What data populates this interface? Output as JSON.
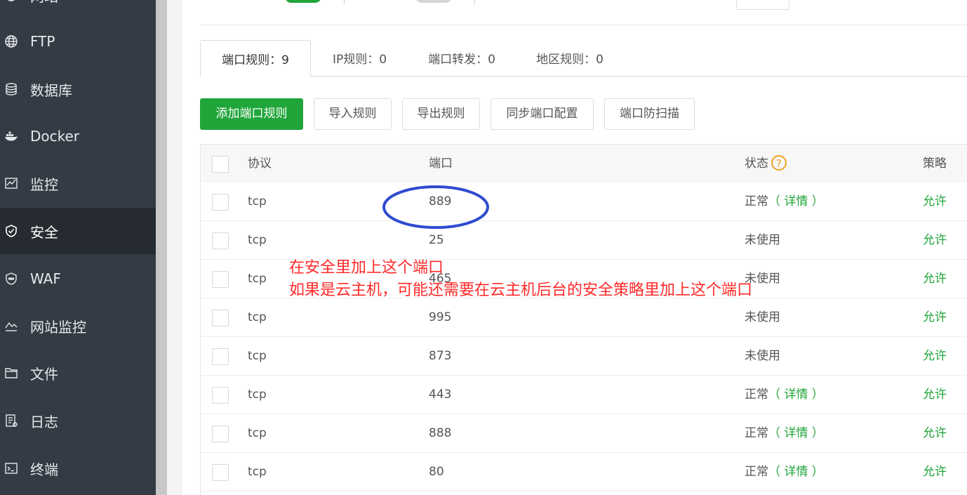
{
  "sidebar": {
    "items": [
      {
        "label": "网站",
        "icon": "globe-icon"
      },
      {
        "label": "FTP",
        "icon": "globe-icon"
      },
      {
        "label": "数据库",
        "icon": "database-icon"
      },
      {
        "label": "Docker",
        "icon": "docker-icon"
      },
      {
        "label": "监控",
        "icon": "monitor-chart-icon"
      },
      {
        "label": "安全",
        "icon": "shield-icon",
        "active": true
      },
      {
        "label": "WAF",
        "icon": "waf-shield-icon"
      },
      {
        "label": "网站监控",
        "icon": "line-chart-icon"
      },
      {
        "label": "文件",
        "icon": "folder-icon"
      },
      {
        "label": "日志",
        "icon": "log-file-icon"
      },
      {
        "label": "终端",
        "icon": "terminal-icon"
      }
    ]
  },
  "tabs": [
    {
      "label": "端口规则：9",
      "active": true
    },
    {
      "label": "IP规则：0"
    },
    {
      "label": "端口转发：0"
    },
    {
      "label": "地区规则：0"
    }
  ],
  "toolbar": {
    "add_port_rule": "添加端口规则",
    "import_rules": "导入规则",
    "export_rules": "导出规则",
    "sync_port_config": "同步端口配置",
    "port_anti_scan": "端口防扫描"
  },
  "table": {
    "headers": {
      "protocol": "协议",
      "port": "端口",
      "status": "状态",
      "policy": "策略",
      "help": "?"
    },
    "rows": [
      {
        "protocol": "tcp",
        "port": "889",
        "status": "正常",
        "detail": "（ 详情 ）",
        "policy": "允许"
      },
      {
        "protocol": "tcp",
        "port": "25",
        "status": "未使用",
        "detail": "",
        "policy": "允许"
      },
      {
        "protocol": "tcp",
        "port": "465",
        "status": "未使用",
        "detail": "",
        "policy": "允许"
      },
      {
        "protocol": "tcp",
        "port": "995",
        "status": "未使用",
        "detail": "",
        "policy": "允许"
      },
      {
        "protocol": "tcp",
        "port": "873",
        "status": "未使用",
        "detail": "",
        "policy": "允许"
      },
      {
        "protocol": "tcp",
        "port": "443",
        "status": "正常",
        "detail": "（ 详情 ）",
        "policy": "允许"
      },
      {
        "protocol": "tcp",
        "port": "888",
        "status": "正常",
        "detail": "（ 详情 ）",
        "policy": "允许"
      },
      {
        "protocol": "tcp",
        "port": "80",
        "status": "正常",
        "detail": "（ 详情 ）",
        "policy": "允许"
      }
    ]
  },
  "annotation": {
    "line1": "在安全里加上这个端口",
    "line2": "如果是云主机，可能还需要在云主机后台的安全策略里加上这个端口",
    "color": "#ff2a2a",
    "circle_color": "#2f4bd0"
  },
  "colors": {
    "accent": "#20a53a",
    "sidebar_bg": "#333b44",
    "sidebar_active": "#262b31",
    "help": "#f0a020"
  }
}
